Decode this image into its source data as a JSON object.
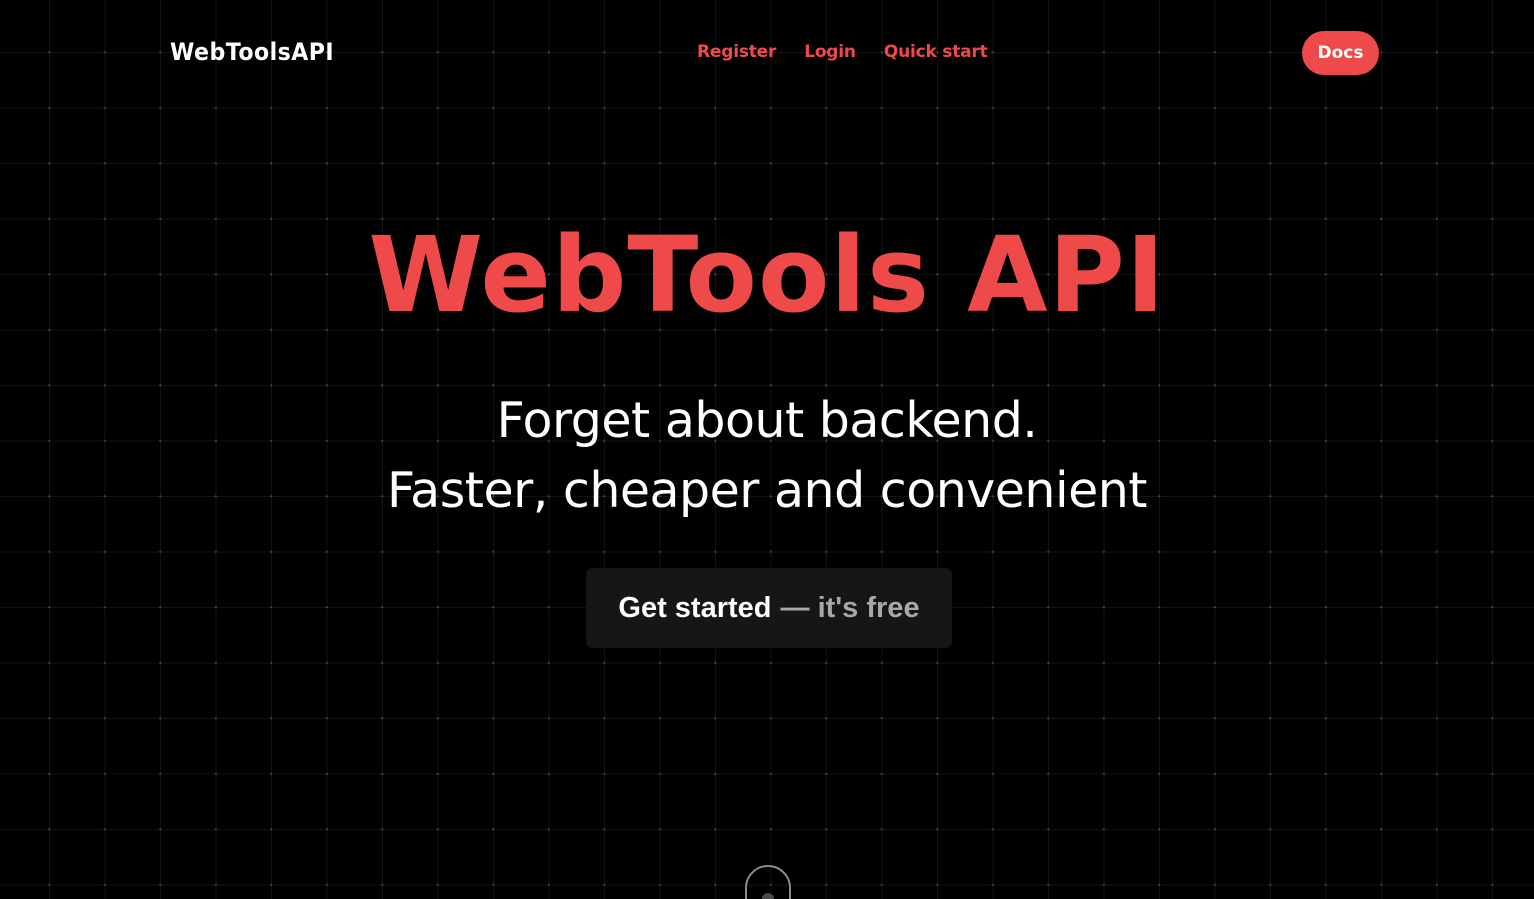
{
  "header": {
    "logo_text": "WebToolsAPI",
    "nav": [
      {
        "label": "Register"
      },
      {
        "label": "Login"
      },
      {
        "label": "Quick start"
      }
    ],
    "docs_label": "Docs"
  },
  "hero": {
    "title": "WebTools API",
    "tagline_line1": "Forget about backend.",
    "tagline_line2": "Faster, cheaper and convenient",
    "cta_main": "Get started",
    "cta_sub": "— it's free"
  },
  "colors": {
    "accent": "#ef4a4a",
    "background": "#000000",
    "cta_background": "#161616"
  },
  "icons": {
    "scroll": "mouse-scroll-icon"
  }
}
